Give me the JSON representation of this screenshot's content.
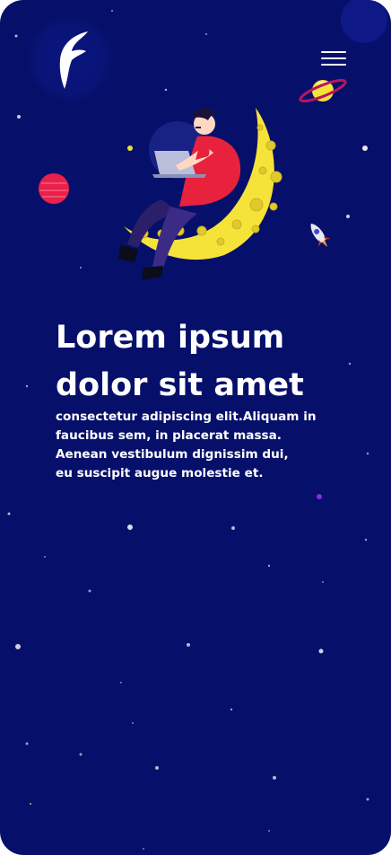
{
  "theme": {
    "background": "#06106a",
    "accent_yellow": "#f6e33a",
    "accent_red": "#e8213c",
    "text": "#ffffff"
  },
  "header": {
    "logo_icon": "f-logo-icon",
    "menu_icon": "hamburger-menu-icon"
  },
  "hero": {
    "illustration": "person-with-laptop-on-crescent-moon",
    "title_line_1": "Lorem ipsum",
    "title_line_2": "dolor sit amet",
    "body_lines": [
      "consectetur adipiscing elit.Aliquam in",
      "faucibus sem, in placerat massa.",
      "Aenean vestibulum dignissim dui,",
      "eu suscipit augue molestie et."
    ]
  },
  "decorations": {
    "planet_ringed": "ringed-planet-icon",
    "planet_red": "red-planet-icon",
    "rocket": "rocket-icon"
  }
}
